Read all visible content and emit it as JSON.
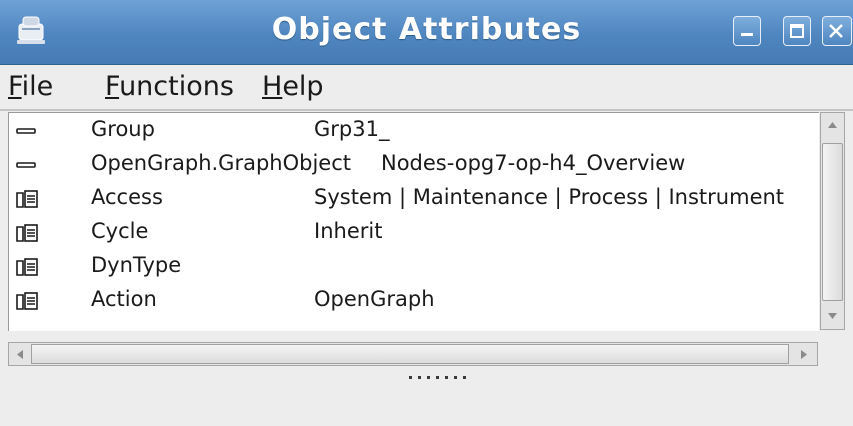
{
  "window": {
    "title": "Object Attributes",
    "title_color": "#4f86c0",
    "icons": [
      "app-icon",
      "minimize-icon",
      "maximize-icon",
      "close-icon"
    ]
  },
  "menubar": {
    "items": [
      {
        "mnemonic": "F",
        "rest": "ile"
      },
      {
        "mnemonic": "F",
        "rest": "unctions"
      },
      {
        "mnemonic": "H",
        "rest": "elp"
      }
    ]
  },
  "attributes": {
    "rows": [
      {
        "icon": "attribute-icon",
        "name": "Group",
        "value": "Grp31_"
      },
      {
        "icon": "attribute-icon",
        "name": "OpenGraph.GraphObject",
        "value": "Nodes-opg7-op-h4_Overview"
      },
      {
        "icon": "folder-icon",
        "name": "Access",
        "value": "System | Maintenance | Process | Instrument"
      },
      {
        "icon": "folder-icon",
        "name": "Cycle",
        "value": "Inherit"
      },
      {
        "icon": "folder-icon",
        "name": "DynType",
        "value": ""
      },
      {
        "icon": "folder-icon",
        "name": "Action",
        "value": "OpenGraph"
      }
    ]
  }
}
